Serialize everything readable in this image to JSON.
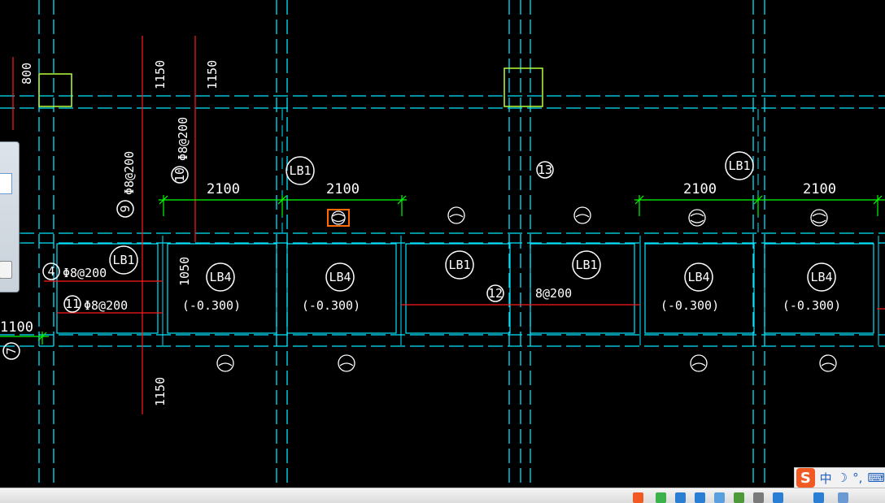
{
  "drawing": {
    "dimensions": {
      "dim_2100": "2100",
      "dim_1150": "1150",
      "dim_800": "800",
      "dim_1050": "1050",
      "dim_1100": "1100"
    },
    "slabs": {
      "lb1": "LB1",
      "lb4": "LB4",
      "elevation": "(-0.300)"
    },
    "rebar": {
      "r9": "9",
      "r10": "10",
      "r4": "4",
      "r11": "11",
      "r12": "12",
      "r13": "13",
      "r7": "7",
      "spec_200": "Φ8@200",
      "spec_200_short": "8@200"
    }
  },
  "ime": {
    "logo": "S",
    "lang": "中",
    "moon": "☽",
    "punct": "°,",
    "keyboard": "⌨"
  },
  "colors": {
    "background": "#000000",
    "axis": "#00e5ff",
    "dimension": "#00ff00",
    "rebar": "#ff1a1a",
    "column": "#b4ff3c",
    "selection": "#ff6a00",
    "text": "#ffffff"
  }
}
